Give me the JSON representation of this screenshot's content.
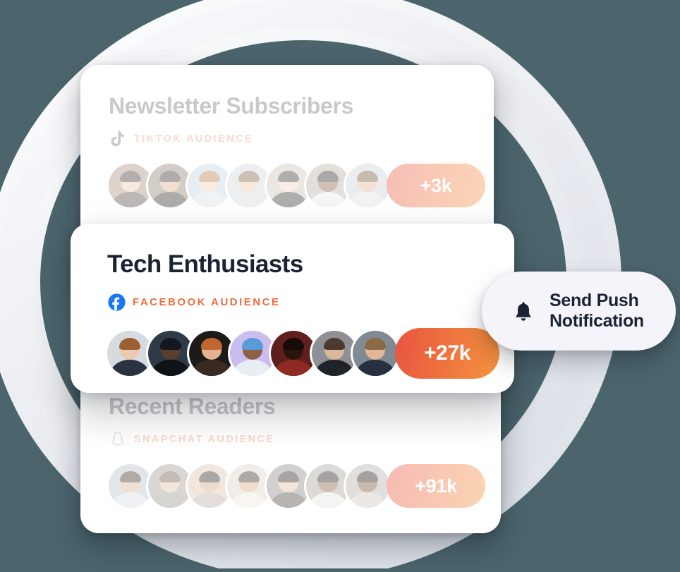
{
  "background": {
    "page_color": "#4C656D",
    "ring_color": "#eceef2"
  },
  "theme": {
    "accent_orange": "#ef6c3d",
    "accent_orange_light": "#f0a183",
    "pill_gradient_start": "#e8543f",
    "pill_gradient_end": "#f5943f",
    "facebook_blue": "#1877f2",
    "title_dark": "#1b2333",
    "title_muted": "#6f7278"
  },
  "cards": [
    {
      "id": "newsletter-subscribers",
      "title": "Newsletter Subscribers",
      "source_icon": "tiktok-icon",
      "source_label": "TIKTOK AUDIENCE",
      "count_badge": "+3k",
      "avatar_count": 7,
      "state": "faded",
      "avatars": [
        {
          "alt": "avatar-1",
          "bg": "#a58d7a",
          "skin": "#e6c4a6",
          "hair": "#3b2f2a",
          "body": "#4e4640"
        },
        {
          "alt": "avatar-2",
          "bg": "#8d7b6d",
          "skin": "#d9ab86",
          "hair": "#2f2723",
          "body": "#2b2724"
        },
        {
          "alt": "avatar-3",
          "bg": "#bfd3df",
          "skin": "#f0cdb3",
          "hair": "#b4733f",
          "body": "#d8dce0"
        },
        {
          "alt": "avatar-4",
          "bg": "#cfd2d4",
          "skin": "#e8c4a3",
          "hair": "#7d5a3c",
          "body": "#cfd4d8"
        },
        {
          "alt": "avatar-5",
          "bg": "#c7bfb6",
          "skin": "#ead4c0",
          "hair": "#2d2a28",
          "body": "#2e2c2b"
        },
        {
          "alt": "avatar-6",
          "bg": "#b3aaa2",
          "skin": "#8b5a3c",
          "hair": "#241c18",
          "body": "#e3e5e7"
        },
        {
          "alt": "avatar-7",
          "bg": "#c9ccd0",
          "skin": "#dcb393",
          "hair": "#6b4c32",
          "body": "#dbdde0"
        }
      ]
    },
    {
      "id": "tech-enthusiasts",
      "title": "Tech Enthusiasts",
      "source_icon": "facebook-icon",
      "source_label": "FACEBOOK AUDIENCE",
      "count_badge": "+27k",
      "avatar_count": 7,
      "state": "active",
      "avatars": [
        {
          "alt": "avatar-1",
          "bg": "#d6dbe0",
          "skin": "#eac9b0",
          "hair": "#9b5f33",
          "body": "#2b3242"
        },
        {
          "alt": "avatar-2",
          "bg": "#2f3a47",
          "skin": "#5a3d2c",
          "hair": "#14181e",
          "body": "#0f1318"
        },
        {
          "alt": "avatar-3",
          "bg": "#1d1b1a",
          "skin": "#e3b392",
          "hair": "#c0672f",
          "body": "#3a2a22"
        },
        {
          "alt": "avatar-4",
          "bg": "#cbbdf0",
          "skin": "#8a6148",
          "hair": "#5a9ad6",
          "body": "#e9eef4"
        },
        {
          "alt": "avatar-5",
          "bg": "#5f201d",
          "skin": "#2a1410",
          "hair": "#170a08",
          "body": "#8e2a22"
        },
        {
          "alt": "avatar-6",
          "bg": "#8e9096",
          "skin": "#d9b79c",
          "hair": "#4a3a30",
          "body": "#20232a"
        },
        {
          "alt": "avatar-7",
          "bg": "#7f8a92",
          "skin": "#e0b695",
          "hair": "#8a6a46",
          "body": "#283040"
        }
      ]
    },
    {
      "id": "recent-readers",
      "title": "Recent Readers",
      "source_icon": "snapchat-icon",
      "source_label": "SNAPCHAT AUDIENCE",
      "count_badge": "+91k",
      "avatar_count": 7,
      "state": "faded",
      "avatars": [
        {
          "alt": "avatar-1",
          "bg": "#b9c0c6",
          "skin": "#d9b194",
          "hair": "#3a2e26",
          "body": "#d8dce0"
        },
        {
          "alt": "avatar-2",
          "bg": "#a39a92",
          "skin": "#e1c0a4",
          "hair": "#6d5b4a",
          "body": "#9a938c"
        },
        {
          "alt": "avatar-3",
          "bg": "#dfc2ae",
          "skin": "#d8a883",
          "hair": "#2c231d",
          "body": "#b8ada2"
        },
        {
          "alt": "avatar-4",
          "bg": "#ddd3c8",
          "skin": "#d6a87f",
          "hair": "#3b2c22",
          "body": "#efe6da"
        },
        {
          "alt": "avatar-5",
          "bg": "#8f8a86",
          "skin": "#e3c1a6",
          "hair": "#241d19",
          "body": "#4d4844"
        },
        {
          "alt": "avatar-6",
          "bg": "#a9a29b",
          "skin": "#8a5e42",
          "hair": "#1f1714",
          "body": "#e7e3de"
        },
        {
          "alt": "avatar-7",
          "bg": "#b4aea8",
          "skin": "#7d5236",
          "hair": "#1c1512",
          "body": "#cdc6bf"
        }
      ]
    }
  ],
  "push_button": {
    "icon": "bell-icon",
    "line1": "Send Push",
    "line2": "Notification"
  }
}
